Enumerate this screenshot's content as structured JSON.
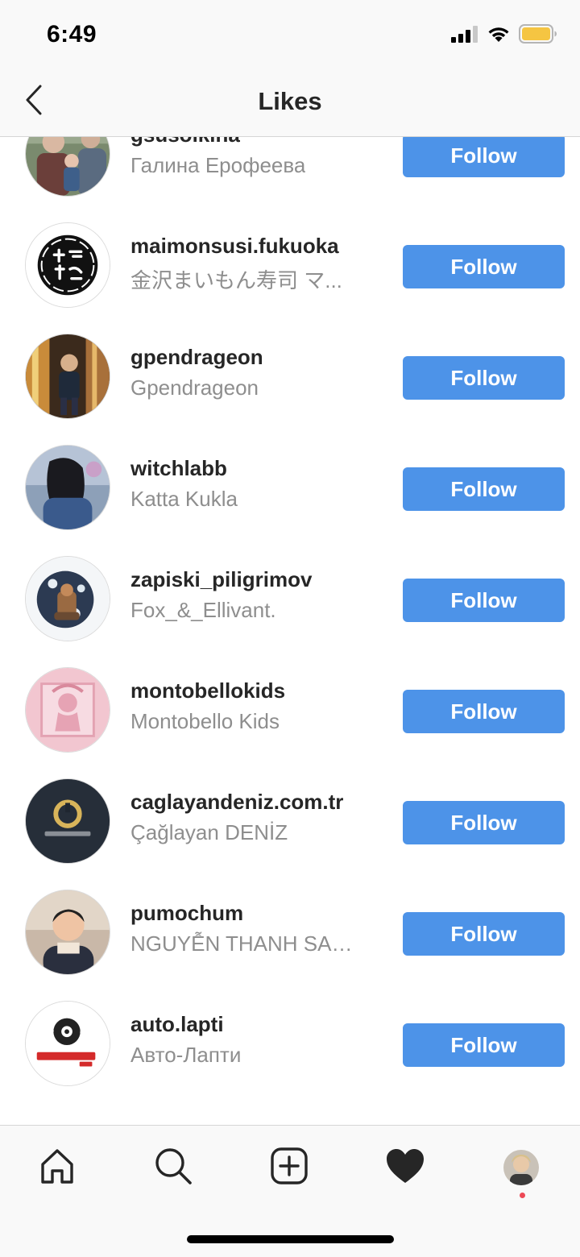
{
  "status_bar": {
    "time": "6:49",
    "icons": [
      "cellular-signal-icon",
      "wifi-icon",
      "battery-icon"
    ],
    "battery_color": "#f5c542"
  },
  "header": {
    "back_icon": "chevron-left-icon",
    "title": "Likes"
  },
  "colors": {
    "follow_button": "#4d93e8",
    "username": "#262626",
    "fullname": "#8e8e8e",
    "notification_dot": "#ed4956"
  },
  "users": [
    {
      "username": "gsusolkina",
      "full_name": "Галина Ерофеева",
      "button": "Follow"
    },
    {
      "username": "maimonsusi.fukuoka",
      "full_name": "金沢まいもん寿司 マ...",
      "button": "Follow"
    },
    {
      "username": "gpendrageon",
      "full_name": "Gpendrageon",
      "button": "Follow"
    },
    {
      "username": "witchlabb",
      "full_name": "Katta Kukla",
      "button": "Follow"
    },
    {
      "username": "zapiski_piligrimov",
      "full_name": "Fox_&_Ellivant.",
      "button": "Follow"
    },
    {
      "username": "montobellokids",
      "full_name": "Montobello Kids",
      "button": "Follow"
    },
    {
      "username": "caglayandeniz.com.tr",
      "full_name": "Çağlayan DENİZ",
      "button": "Follow"
    },
    {
      "username": "pumochum",
      "full_name": "NGUYỄN THANH SANG",
      "button": "Follow"
    },
    {
      "username": "auto.lapti",
      "full_name": "Авто-Лапти",
      "button": "Follow"
    }
  ],
  "tab_bar": {
    "tabs": [
      "home-icon",
      "search-icon",
      "new-post-icon",
      "activity-heart-icon",
      "profile-avatar"
    ],
    "active": "activity-heart-icon"
  }
}
